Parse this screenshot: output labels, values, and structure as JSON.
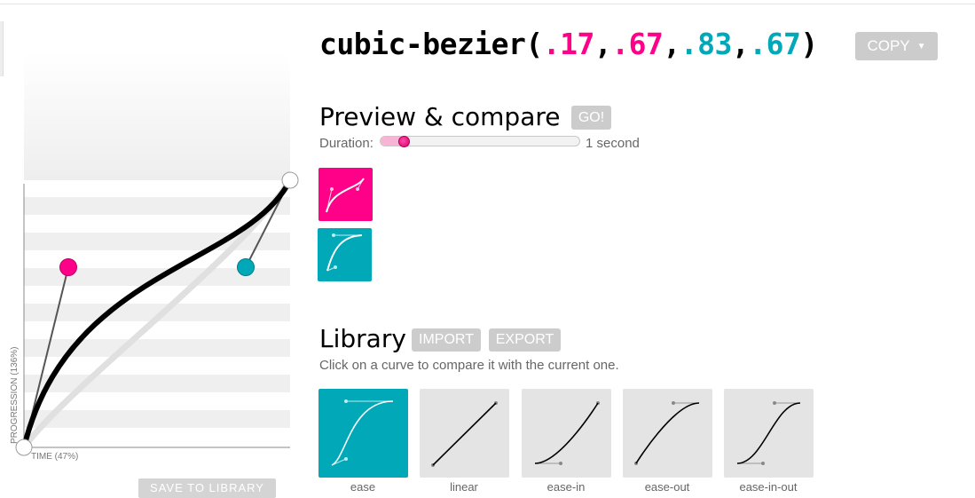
{
  "bezier": {
    "prefix": "cubic-bezier(",
    "p1x": ".17",
    "p1y": ".67",
    "p2x": ".83",
    "p2y": ".67",
    "suffix": ")",
    "comma": ","
  },
  "toolbar": {
    "copy_label": "COPY",
    "copy_caret": "▼"
  },
  "editor": {
    "progression_label": "PROGRESSION (136%)",
    "time_label": "TIME (47%)",
    "save_label": "SAVE TO LIBRARY",
    "handle_colors": {
      "p1": "#ff0088",
      "p2": "#00a8b8"
    }
  },
  "preview": {
    "heading": "Preview & compare",
    "go_label": "GO!",
    "duration_label": "Duration:",
    "duration_value": "1 second",
    "duration_fraction": 0.12
  },
  "compare_swatches": [
    {
      "name": "current",
      "color": "#ff0088",
      "icon": "current-curve-icon"
    },
    {
      "name": "compare",
      "color": "#00a8b8",
      "icon": "ease-curve-icon"
    }
  ],
  "library": {
    "heading": "Library",
    "import_label": "IMPORT",
    "export_label": "EXPORT",
    "hint": "Click on a curve to compare it with the current one.",
    "items": [
      {
        "name": "ease",
        "active": true
      },
      {
        "name": "linear",
        "active": false
      },
      {
        "name": "ease-in",
        "active": false
      },
      {
        "name": "ease-out",
        "active": false
      },
      {
        "name": "ease-in-out",
        "active": false
      }
    ]
  },
  "colors": {
    "pink": "#ff0088",
    "teal": "#00a8b8",
    "button_gray": "#cccccc"
  }
}
